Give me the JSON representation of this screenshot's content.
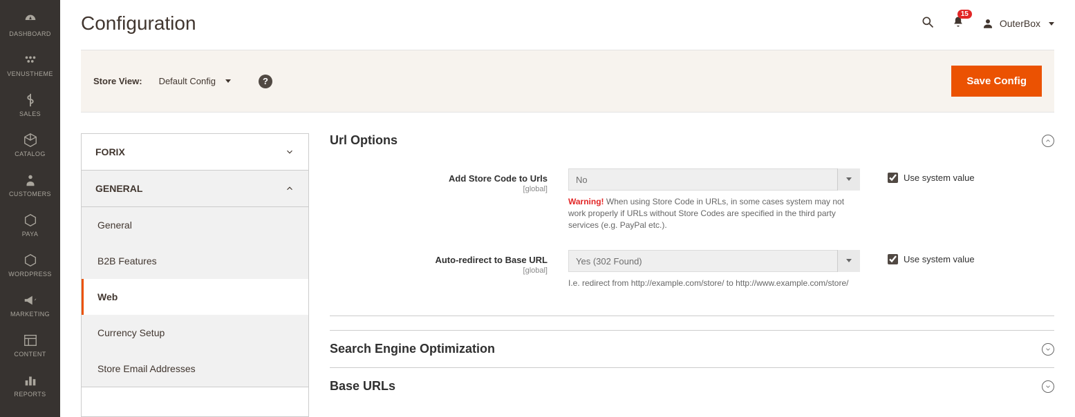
{
  "sidebar": [
    {
      "label": "DASHBOARD",
      "icon": "gauge"
    },
    {
      "label": "VENUSTHEME",
      "icon": "dots"
    },
    {
      "label": "SALES",
      "icon": "dollar"
    },
    {
      "label": "CATALOG",
      "icon": "cube"
    },
    {
      "label": "CUSTOMERS",
      "icon": "person"
    },
    {
      "label": "PAYA",
      "icon": "hex"
    },
    {
      "label": "WORDPRESS",
      "icon": "hex"
    },
    {
      "label": "MARKETING",
      "icon": "megaphone"
    },
    {
      "label": "CONTENT",
      "icon": "layout"
    },
    {
      "label": "REPORTS",
      "icon": "bars"
    }
  ],
  "header": {
    "title": "Configuration",
    "notif_count": "15",
    "user": "OuterBox"
  },
  "storebar": {
    "label": "Store View:",
    "value": "Default Config",
    "save": "Save Config"
  },
  "config_nav": {
    "groups": [
      {
        "label": "FORIX",
        "expanded": false
      },
      {
        "label": "GENERAL",
        "expanded": true,
        "items": [
          "General",
          "B2B Features",
          "Web",
          "Currency Setup",
          "Store Email Addresses"
        ],
        "active": "Web"
      }
    ]
  },
  "content": {
    "section_title": "Url Options",
    "fields": [
      {
        "label": "Add Store Code to Urls",
        "scope": "[global]",
        "value": "No",
        "use_system": "Use system value",
        "note_warn": "Warning!",
        "note": "When using Store Code in URLs, in some cases system may not work properly if URLs without Store Codes are specified in the third party services (e.g. PayPal etc.)."
      },
      {
        "label": "Auto-redirect to Base URL",
        "scope": "[global]",
        "value": "Yes (302 Found)",
        "use_system": "Use system value",
        "note": "I.e. redirect from http://example.com/store/ to http://www.example.com/store/"
      }
    ],
    "collapsed": [
      "Search Engine Optimization",
      "Base URLs"
    ]
  }
}
